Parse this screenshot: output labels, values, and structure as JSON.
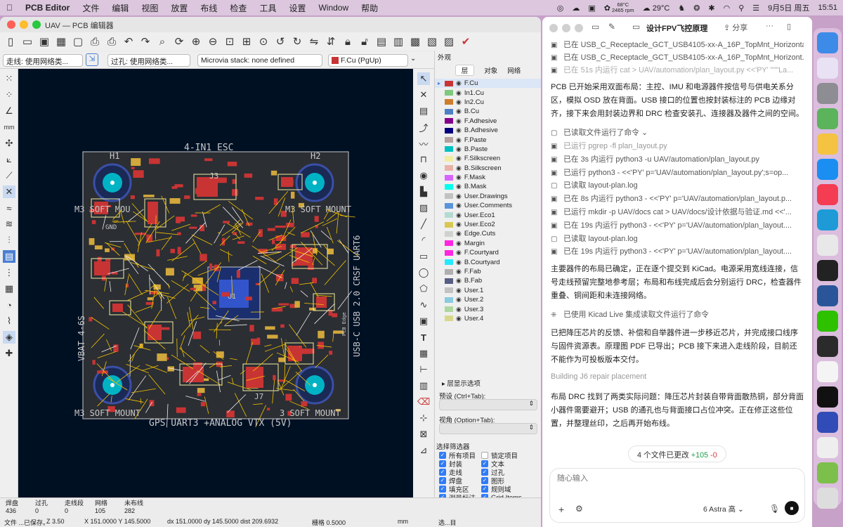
{
  "menubar": {
    "apple": "",
    "app": "PCB Editor",
    "items": [
      "文件",
      "编辑",
      "视图",
      "放置",
      "布线",
      "检查",
      "工具",
      "设置",
      "Window",
      "帮助"
    ],
    "temp_small": "68°C",
    "rpm": "2465 rpm",
    "weather": "29°C",
    "date": "9月5日 周五",
    "time": "15:51"
  },
  "pcb": {
    "title": "UAV — PCB 编辑器",
    "track_combo": "走线: 使用网络类...",
    "via_combo": "过孔: 使用网络类...",
    "microvia": "Microvia stack: none defined",
    "layer_combo": "F.Cu (PgUp)",
    "canvas_labels": {
      "esc": "4-IN1 ESC",
      "gps": "GPS UART3 +ANALOG VTX (5V)",
      "vbat": "VBAT 4-6S",
      "usbc": "USB-C USB 2.0 CRSF UART6",
      "m3_tl": "M3 SOFT MOU",
      "m3_tr": "M3 SOFT MOUNT",
      "m3_bl": "M3 SOFT MOUNT",
      "m3_br": "3 SOFT MOUNT",
      "h1": "H1",
      "h2": "H2",
      "u1": "U1",
      "j3": "J3",
      "j7": "J7",
      "gnd": "GND",
      "pcb_edge": "PCB Edge"
    },
    "appearance": {
      "title": "外观",
      "tabs": [
        "层",
        "对象",
        "网络"
      ],
      "layers": [
        {
          "name": "F.Cu",
          "color": "#c83434"
        },
        {
          "name": "In1.Cu",
          "color": "#7fc87f"
        },
        {
          "name": "In2.Cu",
          "color": "#ce7d2c"
        },
        {
          "name": "B.Cu",
          "color": "#4d7fc4"
        },
        {
          "name": "F.Adhesive",
          "color": "#84008a"
        },
        {
          "name": "B.Adhesive",
          "color": "#02007c"
        },
        {
          "name": "F.Paste",
          "color": "#b4a0a0"
        },
        {
          "name": "B.Paste",
          "color": "#00c2c2"
        },
        {
          "name": "F.Silkscreen",
          "color": "#f2eda1"
        },
        {
          "name": "B.Silkscreen",
          "color": "#e8b2a7"
        },
        {
          "name": "F.Mask",
          "color": "#d864ff"
        },
        {
          "name": "B.Mask",
          "color": "#02ffee"
        },
        {
          "name": "User.Drawings",
          "color": "#c2c2c2"
        },
        {
          "name": "User.Comments",
          "color": "#5994dc"
        },
        {
          "name": "User.Eco1",
          "color": "#b4dbd2"
        },
        {
          "name": "User.Eco2",
          "color": "#d8c852"
        },
        {
          "name": "Edge.Cuts",
          "color": "#d0d2cd"
        },
        {
          "name": "Margin",
          "color": "#ff26e2"
        },
        {
          "name": "F.Courtyard",
          "color": "#ff26e2"
        },
        {
          "name": "B.Courtyard",
          "color": "#26e9ff"
        },
        {
          "name": "F.Fab",
          "color": "#afafaf"
        },
        {
          "name": "B.Fab",
          "color": "#585d84"
        },
        {
          "name": "User.1",
          "color": "#c2c2c2"
        },
        {
          "name": "User.2",
          "color": "#89cbdf"
        },
        {
          "name": "User.3",
          "color": "#aed7a0"
        },
        {
          "name": "User.4",
          "color": "#d8d88c"
        }
      ],
      "layer_display": "层显示选项",
      "preset_label": "预设 (Ctrl+Tab):",
      "view_label": "视角 (Option+Tab):"
    },
    "filter": {
      "title": "选择筛选器",
      "items": [
        {
          "label": "所有项目",
          "checked": true
        },
        {
          "label": "锁定项目",
          "checked": false
        },
        {
          "label": "封装",
          "checked": true
        },
        {
          "label": "文本",
          "checked": true
        },
        {
          "label": "走线",
          "checked": true
        },
        {
          "label": "过孔",
          "checked": true
        },
        {
          "label": "焊盘",
          "checked": true
        },
        {
          "label": "图形",
          "checked": true
        },
        {
          "label": "填充区",
          "checked": true
        },
        {
          "label": "规则域",
          "checked": true
        },
        {
          "label": "测量标注",
          "checked": true
        },
        {
          "label": "Grid Items",
          "checked": true
        },
        {
          "label": "点",
          "checked": true
        },
        {
          "label": "其他项目",
          "checked": true
        }
      ]
    },
    "stats": [
      {
        "label": "焊盘",
        "value": "436"
      },
      {
        "label": "过孔",
        "value": "0"
      },
      {
        "label": "走线段",
        "value": "0"
      },
      {
        "label": "网络",
        "value": "105"
      },
      {
        "label": "未布线",
        "value": "282"
      }
    ],
    "status": {
      "msg": "文件 ...已保存。",
      "z": "Z 3.50",
      "xy": "X 151.0000  Y 145.5000",
      "dxy": "dx 151.0000  dy 145.5000  dist 209.6932",
      "grid": "栅格 0.5000",
      "unit": "mm",
      "sel": "选...目"
    }
  },
  "chat": {
    "title": "设计FPV飞控原理",
    "share": "分享",
    "top_lines": [
      "已在 USB_C_Receptacle_GCT_USB4105-xx-A_16P_TopMnt_Horizontal...",
      "已在 USB_C_Receptacle_GCT_USB4105-xx-A_16P_TopMnt_Horizont...",
      "已在 51s 内运行 cat > UAV/automation/plan_layout.py <<'PY' \"\"\"La..."
    ],
    "para1": "PCB 已开始采用双面布局：主控、IMU 和电源器件按信号与供电关系分区，模拟 OSD 放在背面。USB 接口的位置也按封装标注的 PCB 边缘对齐，接下来会用封装边界和 DRC 检查安装孔、连接器及器件之间的空间。",
    "group1": "已读取文件运行了命令",
    "tools": [
      "已运行 pgrep -fl plan_layout.py",
      "已在 3s 内运行 python3 -u UAV/automation/plan_layout.py",
      "已运行 python3 - <<'PY' p='UAV/automation/plan_layout.py';s=op...",
      "已读取 layout-plan.log",
      "已在 8s 内运行 python3 - <<'PY' p='UAV/automation/plan_layout.p...",
      "已运行 mkdir -p UAV/docs cat > UAV/docs/设计依据与验证.md <<'...",
      "已在 19s 内运行 python3 - <<'PY' p='UAV/automation/plan_layout....",
      "已读取 layout-plan.log",
      "已在 19s 内运行 python3 - <<'PY' p='UAV/automation/plan_layout...."
    ],
    "para2": "主要器件的布局已确定，正在逐个提交到 KiCad。电源采用宽线连接，信号走线预留完整地参考层；布局和布线完成后会分别运行 DRC，检查器件重叠、铜间距和未连接网络。",
    "group2": "已使用 Kicad Live 集成读取文件运行了命令",
    "para3": "已把降压芯片的反馈、补偿和自举器件进一步移近芯片，并完成接口线序与固件资源表。原理图 PDF 已导出；PCB 接下来进入走线阶段，目前还不能作为可投板版本交付。",
    "building": "Building J6 repair placement",
    "para4": "布局 DRC 找到了两类实际问题：降压芯片封装自带背面散热铜，部分背面小器件需要避开；USB 的通孔也与背面接口占位冲突。正在修正这些位置，并整理丝印，之后再开始布线。",
    "files": "4 个文件已更改",
    "add": "+105",
    "del": "-0",
    "input_placeholder": "随心输入",
    "model": "6 Astra 高"
  },
  "dock": [
    {
      "name": "finder-icon",
      "color": "#3d8be8"
    },
    {
      "name": "launchpad-icon",
      "color": "#e9e2f4"
    },
    {
      "name": "settings-icon",
      "color": "#8d8d93"
    },
    {
      "name": "maps-icon",
      "color": "#5bb35b"
    },
    {
      "name": "photos-icon",
      "color": "#f4c342"
    },
    {
      "name": "appstore-icon",
      "color": "#1b8ef2"
    },
    {
      "name": "music-icon",
      "color": "#f43c53"
    },
    {
      "name": "edge-icon",
      "color": "#1e9bd7"
    },
    {
      "name": "chrome-icon",
      "color": "#e8e8e8"
    },
    {
      "name": "avatar-icon",
      "color": "#222"
    },
    {
      "name": "word-icon",
      "color": "#2a5699"
    },
    {
      "name": "wechat-icon",
      "color": "#2dc100"
    },
    {
      "name": "terminal-icon",
      "color": "#2b2b2b"
    },
    {
      "name": "chatgpt-icon",
      "color": "#f4f4f4"
    },
    {
      "name": "dark-app-icon",
      "color": "#111"
    },
    {
      "name": "kicad-icon",
      "color": "#314cb6"
    },
    {
      "name": "pcb-calc-icon",
      "color": "#eee"
    },
    {
      "name": "gerber-icon",
      "color": "#7cc04b"
    },
    {
      "name": "trash-icon",
      "color": "#ddd"
    }
  ]
}
